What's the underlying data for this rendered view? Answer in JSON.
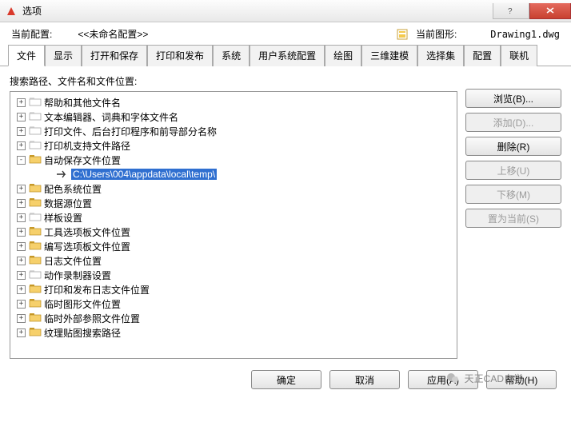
{
  "window": {
    "title": "选项"
  },
  "header": {
    "profile_label": "当前配置:",
    "profile_value": "<<未命名配置>>",
    "drawing_label": "当前图形:",
    "drawing_value": "Drawing1.dwg"
  },
  "tabs": [
    "文件",
    "显示",
    "打开和保存",
    "打印和发布",
    "系统",
    "用户系统配置",
    "绘图",
    "三维建模",
    "选择集",
    "配置",
    "联机"
  ],
  "active_tab": 0,
  "section_label": "搜索路径、文件名和文件位置:",
  "tree": [
    {
      "exp": "+",
      "icon": "w",
      "label": "帮助和其他文件名",
      "indent": 0
    },
    {
      "exp": "+",
      "icon": "w",
      "label": "文本编辑器、词典和字体文件名",
      "indent": 0
    },
    {
      "exp": "+",
      "icon": "w",
      "label": "打印文件、后台打印程序和前导部分名称",
      "indent": 0
    },
    {
      "exp": "+",
      "icon": "w",
      "label": "打印机支持文件路径",
      "indent": 0
    },
    {
      "exp": "-",
      "icon": "y",
      "label": "自动保存文件位置",
      "indent": 0
    },
    {
      "exp": " ",
      "icon": "a",
      "label": "C:\\Users\\004\\appdata\\local\\temp\\",
      "indent": 1,
      "selected": true
    },
    {
      "exp": "+",
      "icon": "y",
      "label": "配色系统位置",
      "indent": 0
    },
    {
      "exp": "+",
      "icon": "y",
      "label": "数据源位置",
      "indent": 0
    },
    {
      "exp": "+",
      "icon": "w",
      "label": "样板设置",
      "indent": 0
    },
    {
      "exp": "+",
      "icon": "y",
      "label": "工具选项板文件位置",
      "indent": 0
    },
    {
      "exp": "+",
      "icon": "y",
      "label": "编写选项板文件位置",
      "indent": 0
    },
    {
      "exp": "+",
      "icon": "y",
      "label": "日志文件位置",
      "indent": 0
    },
    {
      "exp": "+",
      "icon": "w",
      "label": "动作录制器设置",
      "indent": 0
    },
    {
      "exp": "+",
      "icon": "y",
      "label": "打印和发布日志文件位置",
      "indent": 0
    },
    {
      "exp": "+",
      "icon": "y",
      "label": "临时图形文件位置",
      "indent": 0
    },
    {
      "exp": "+",
      "icon": "y",
      "label": "临时外部参照文件位置",
      "indent": 0
    },
    {
      "exp": "+",
      "icon": "y",
      "label": "纹理贴图搜索路径",
      "indent": 0
    }
  ],
  "side_buttons": [
    {
      "label": "浏览(B)...",
      "enabled": true
    },
    {
      "label": "添加(D)...",
      "enabled": false
    },
    {
      "label": "删除(R)",
      "enabled": true
    },
    {
      "label": "上移(U)",
      "enabled": false
    },
    {
      "label": "下移(M)",
      "enabled": false
    },
    {
      "label": "置为当前(S)",
      "enabled": false
    }
  ],
  "footer_brand": "天正CAD自学",
  "dialog_buttons": {
    "ok": "确定",
    "cancel": "取消",
    "apply": "应用(A)",
    "help": "帮助(H)"
  }
}
